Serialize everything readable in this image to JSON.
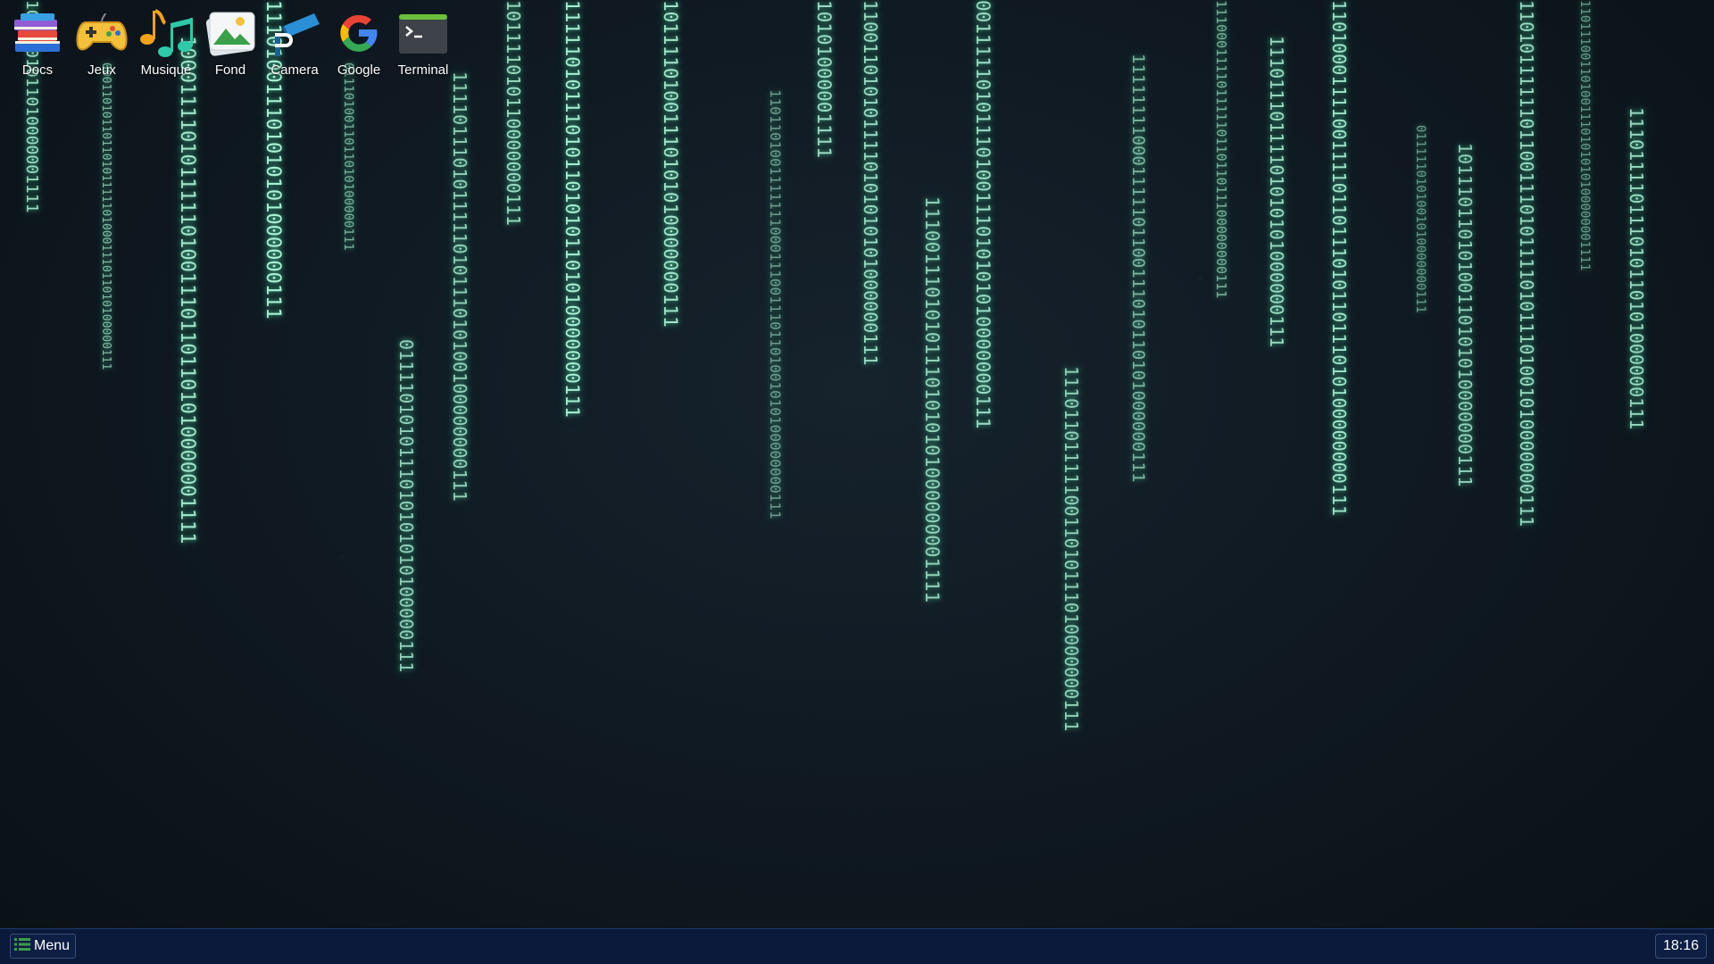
{
  "desktop": {
    "icons": [
      {
        "label": "Docs",
        "icon": "books-icon"
      },
      {
        "label": "Jeux",
        "icon": "gamepad-icon"
      },
      {
        "label": "Musique",
        "icon": "music-notes-icon"
      },
      {
        "label": "Fond",
        "icon": "image-icon"
      },
      {
        "label": "Camera",
        "icon": "camera-icon"
      },
      {
        "label": "Google",
        "icon": "google-icon"
      },
      {
        "label": "Terminal",
        "icon": "terminal-icon"
      }
    ],
    "wallpaper_binary": [
      "1011101011010000001111",
      "00011010110110101111101000111011010100000111",
      "1000111101011111010011101101101010000001111",
      "111010011101010101000000111",
      "0111010011011010100000111",
      "0111101010111010101010100000111",
      "1111011101011111010111010100100000000111",
      "101111010110000000111",
      "1111101011101011010101101010000000111",
      "10111101001110101010000000111",
      "11011010011111110001110011101101001010100000000111",
      "10101000001111",
      "1100110101011110101010101000000111",
      "111001110101011101010101000000001111",
      "00111110101110100111010101010000000111",
      "1110110111110011010111010000000111",
      "111111110001111101100111010110101000000111",
      "1110001111011111011011011100000000111",
      "11101110111101010101000000111",
      "110100011110011110110111010110111010100000000111",
      "0111110101001010000000111",
      "10111011010100110101010000000111",
      "1101011111101100111010111101011101001010000000111",
      "110111001101001110101010100000001111",
      "111011110111010110101000000111"
    ]
  },
  "taskbar": {
    "menu_label": "Menu",
    "menu_icon": "list-icon",
    "clock": "18:16"
  },
  "colors": {
    "matrix_green": "#a8f0d4",
    "taskbar_bg": "#0b1a3a"
  }
}
